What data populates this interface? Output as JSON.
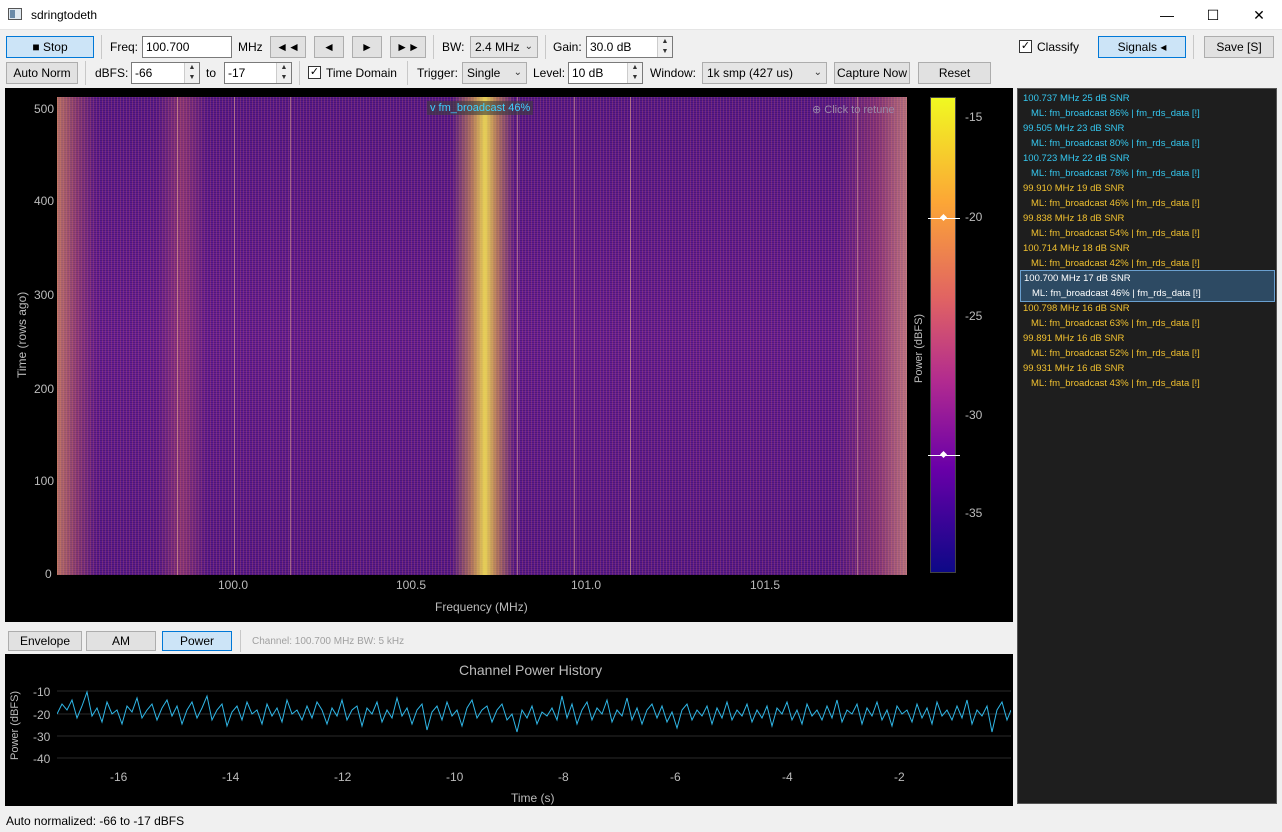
{
  "window": {
    "title": "sdringtodeth",
    "minimize": "—",
    "maximize": "☐",
    "close": "✕"
  },
  "toolbar1": {
    "stop_label": "■  Stop",
    "freq_label": "Freq:",
    "freq_value": "100.700",
    "freq_unit": "MHz",
    "step_buttons": [
      "◄◄",
      "◄",
      "►",
      "►►"
    ],
    "bw_label": "BW:",
    "bw_value": "2.4 MHz",
    "gain_label": "Gain:",
    "gain_value": "30.0 dB",
    "classify_label": "Classify",
    "classify_checked": "✓",
    "signals_label": "Signals ◂",
    "save_label": "Save [S]"
  },
  "toolbar2": {
    "auto_norm_label": "Auto Norm",
    "dbfs_label": "dBFS:",
    "dbfs_min": "-66",
    "to_label": "to",
    "dbfs_max": "-17",
    "time_domain_label": "Time Domain",
    "time_domain_checked": "✓",
    "trigger_label": "Trigger:",
    "trigger_value": "Single",
    "level_label": "Level:",
    "level_value": "10 dB",
    "window_label": "Window:",
    "window_value": "1k smp  (427 us)",
    "capture_label": "Capture Now",
    "reset_label": "Reset"
  },
  "spectrogram": {
    "ylabel": "Time (rows ago)",
    "xlabel": "Frequency (MHz)",
    "yticks": [
      "500",
      "400",
      "300",
      "200",
      "100",
      "0"
    ],
    "xticks": [
      "100.0",
      "100.5",
      "101.0",
      "101.5"
    ],
    "overlay_tag": "v fm_broadcast 46%",
    "click_hint": "⊕ Click to retune",
    "colorbar_label": "Power (dBFS)",
    "colorbar_ticks": [
      "-15",
      "-20",
      "-25",
      "-30",
      "-35"
    ]
  },
  "demod_tabs": [
    "Envelope",
    "AM",
    "Power"
  ],
  "channel_info": "Channel: 100.700 MHz  BW: 5 kHz",
  "history": {
    "title": "Channel Power History",
    "ylabel": "Power (dBFS)",
    "xlabel": "Time (s)",
    "yticks": [
      "-10",
      "-20",
      "-30",
      "-40"
    ],
    "xticks": [
      "-16",
      "-14",
      "-12",
      "-10",
      "-8",
      "-6",
      "-4",
      "-2"
    ]
  },
  "signals": [
    {
      "line1": "100.737 MHz   25 dB SNR",
      "line2": "ML: fm_broadcast 86%  |  fm_rds_data [!]",
      "color": "#35c8f0"
    },
    {
      "line1": "99.505 MHz   23 dB SNR",
      "line2": "ML: fm_broadcast 80%  |  fm_rds_data [!]",
      "color": "#35c8f0"
    },
    {
      "line1": "100.723 MHz   22 dB SNR",
      "line2": "ML: fm_broadcast 78%  |  fm_rds_data [!]",
      "color": "#35c8f0"
    },
    {
      "line1": "99.910 MHz   19 dB SNR",
      "line2": "ML: fm_broadcast 46%  |  fm_rds_data [!]",
      "color": "#f0c030"
    },
    {
      "line1": "99.838 MHz   18 dB SNR",
      "line2": "ML: fm_broadcast 54%  |  fm_rds_data [!]",
      "color": "#f0c030"
    },
    {
      "line1": "100.714 MHz   18 dB SNR",
      "line2": "ML: fm_broadcast 42%  |  fm_rds_data [!]",
      "color": "#f0c030"
    },
    {
      "line1": "100.700 MHz   17 dB SNR",
      "line2": "ML: fm_broadcast 46%  |  fm_rds_data [!]",
      "color": "#ffffff"
    },
    {
      "line1": "100.798 MHz   16 dB SNR",
      "line2": "ML: fm_broadcast 63%  |  fm_rds_data [!]",
      "color": "#f0c030"
    },
    {
      "line1": "99.891 MHz   16 dB SNR",
      "line2": "ML: fm_broadcast 52%  |  fm_rds_data [!]",
      "color": "#f0c030"
    },
    {
      "line1": "99.931 MHz   16 dB SNR",
      "line2": "ML: fm_broadcast 43%  |  fm_rds_data [!]",
      "color": "#f0c030"
    }
  ],
  "status": "Auto normalized: -66 to -17 dBFS"
}
